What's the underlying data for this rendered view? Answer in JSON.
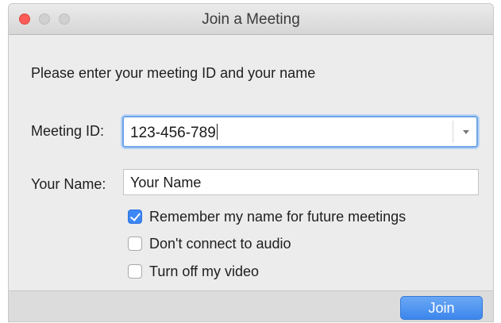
{
  "window": {
    "title": "Join a Meeting"
  },
  "dialog": {
    "prompt": "Please enter your meeting ID and your name",
    "meeting_id": {
      "label": "Meeting ID:",
      "value": "123-456-789"
    },
    "your_name": {
      "label": "Your Name:",
      "value": "Your Name"
    },
    "options": [
      {
        "label": "Remember my name for future meetings",
        "checked": true
      },
      {
        "label": "Don't connect to audio",
        "checked": false
      },
      {
        "label": "Turn off my video",
        "checked": false
      }
    ]
  },
  "footer": {
    "join_label": "Join"
  },
  "colors": {
    "accent": "#3d86f5",
    "close_button": "#fc5b57"
  },
  "icons": {
    "close": "close-dot-icon",
    "minimize": "minimize-dot-icon",
    "maximize": "maximize-dot-icon",
    "dropdown": "chevron-down-icon",
    "check": "checkmark-icon"
  }
}
